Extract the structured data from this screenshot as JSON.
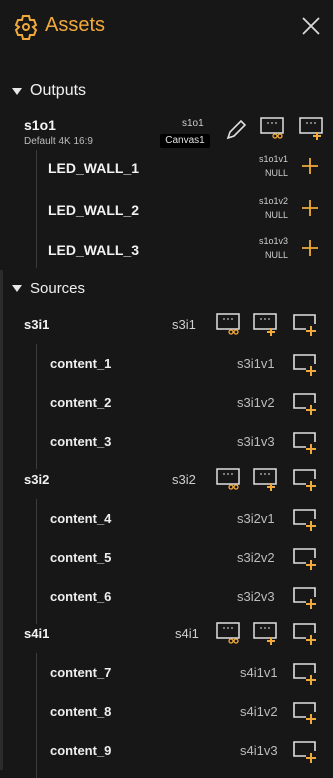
{
  "header": {
    "title": "Assets"
  },
  "outputs": {
    "section_label": "Outputs",
    "name": "s1o1",
    "description": "Default 4K 16:9",
    "id": "s1o1",
    "canvas_label": "Canvas1",
    "items": [
      {
        "name": "LED_WALL_1",
        "id": "s1o1v1",
        "value": "NULL"
      },
      {
        "name": "LED_WALL_2",
        "id": "s1o1v2",
        "value": "NULL"
      },
      {
        "name": "LED_WALL_3",
        "id": "s1o1v3",
        "value": "NULL"
      }
    ]
  },
  "sources": {
    "section_label": "Sources",
    "groups": [
      {
        "name": "s3i1",
        "id": "s3i1",
        "items": [
          {
            "name": "content_1",
            "id": "s3i1v1"
          },
          {
            "name": "content_2",
            "id": "s3i1v2"
          },
          {
            "name": "content_3",
            "id": "s3i1v3"
          }
        ]
      },
      {
        "name": "s3i2",
        "id": "s3i2",
        "items": [
          {
            "name": "content_4",
            "id": "s3i2v1"
          },
          {
            "name": "content_5",
            "id": "s3i2v2"
          },
          {
            "name": "content_6",
            "id": "s3i2v3"
          }
        ]
      },
      {
        "name": "s4i1",
        "id": "s4i1",
        "items": [
          {
            "name": "content_7",
            "id": "s4i1v1"
          },
          {
            "name": "content_8",
            "id": "s4i1v2"
          },
          {
            "name": "content_9",
            "id": "s4i1v3"
          }
        ]
      }
    ]
  },
  "colors": {
    "accent": "#f2a93b",
    "background": "#171717",
    "text": "#e8e8e8"
  },
  "icons": {
    "logo": "gear-cog-icon",
    "close": "close-icon",
    "edit": "pencil-icon",
    "split": "screen-split-icon",
    "add_screen": "screen-add-icon",
    "add_window": "window-add-icon",
    "add": "plus-icon"
  }
}
